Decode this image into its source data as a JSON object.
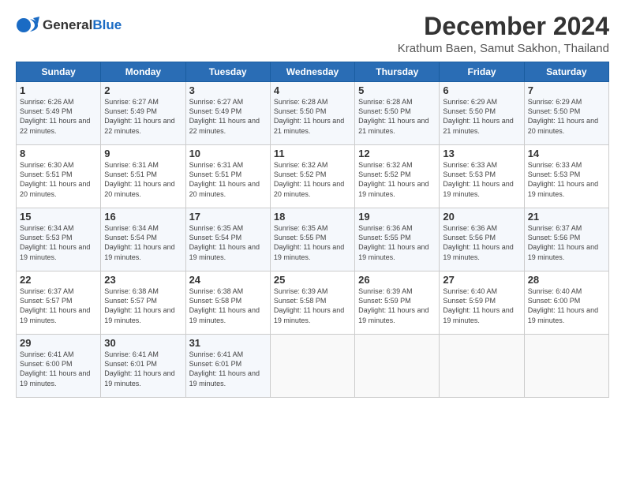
{
  "app": {
    "logo_general": "General",
    "logo_blue": "Blue"
  },
  "header": {
    "month": "December 2024",
    "location": "Krathum Baen, Samut Sakhon, Thailand"
  },
  "weekdays": [
    "Sunday",
    "Monday",
    "Tuesday",
    "Wednesday",
    "Thursday",
    "Friday",
    "Saturday"
  ],
  "weeks": [
    [
      {
        "day": "1",
        "sunrise": "Sunrise: 6:26 AM",
        "sunset": "Sunset: 5:49 PM",
        "daylight": "Daylight: 11 hours and 22 minutes."
      },
      {
        "day": "2",
        "sunrise": "Sunrise: 6:27 AM",
        "sunset": "Sunset: 5:49 PM",
        "daylight": "Daylight: 11 hours and 22 minutes."
      },
      {
        "day": "3",
        "sunrise": "Sunrise: 6:27 AM",
        "sunset": "Sunset: 5:49 PM",
        "daylight": "Daylight: 11 hours and 22 minutes."
      },
      {
        "day": "4",
        "sunrise": "Sunrise: 6:28 AM",
        "sunset": "Sunset: 5:50 PM",
        "daylight": "Daylight: 11 hours and 21 minutes."
      },
      {
        "day": "5",
        "sunrise": "Sunrise: 6:28 AM",
        "sunset": "Sunset: 5:50 PM",
        "daylight": "Daylight: 11 hours and 21 minutes."
      },
      {
        "day": "6",
        "sunrise": "Sunrise: 6:29 AM",
        "sunset": "Sunset: 5:50 PM",
        "daylight": "Daylight: 11 hours and 21 minutes."
      },
      {
        "day": "7",
        "sunrise": "Sunrise: 6:29 AM",
        "sunset": "Sunset: 5:50 PM",
        "daylight": "Daylight: 11 hours and 20 minutes."
      }
    ],
    [
      {
        "day": "8",
        "sunrise": "Sunrise: 6:30 AM",
        "sunset": "Sunset: 5:51 PM",
        "daylight": "Daylight: 11 hours and 20 minutes."
      },
      {
        "day": "9",
        "sunrise": "Sunrise: 6:31 AM",
        "sunset": "Sunset: 5:51 PM",
        "daylight": "Daylight: 11 hours and 20 minutes."
      },
      {
        "day": "10",
        "sunrise": "Sunrise: 6:31 AM",
        "sunset": "Sunset: 5:51 PM",
        "daylight": "Daylight: 11 hours and 20 minutes."
      },
      {
        "day": "11",
        "sunrise": "Sunrise: 6:32 AM",
        "sunset": "Sunset: 5:52 PM",
        "daylight": "Daylight: 11 hours and 20 minutes."
      },
      {
        "day": "12",
        "sunrise": "Sunrise: 6:32 AM",
        "sunset": "Sunset: 5:52 PM",
        "daylight": "Daylight: 11 hours and 19 minutes."
      },
      {
        "day": "13",
        "sunrise": "Sunrise: 6:33 AM",
        "sunset": "Sunset: 5:53 PM",
        "daylight": "Daylight: 11 hours and 19 minutes."
      },
      {
        "day": "14",
        "sunrise": "Sunrise: 6:33 AM",
        "sunset": "Sunset: 5:53 PM",
        "daylight": "Daylight: 11 hours and 19 minutes."
      }
    ],
    [
      {
        "day": "15",
        "sunrise": "Sunrise: 6:34 AM",
        "sunset": "Sunset: 5:53 PM",
        "daylight": "Daylight: 11 hours and 19 minutes."
      },
      {
        "day": "16",
        "sunrise": "Sunrise: 6:34 AM",
        "sunset": "Sunset: 5:54 PM",
        "daylight": "Daylight: 11 hours and 19 minutes."
      },
      {
        "day": "17",
        "sunrise": "Sunrise: 6:35 AM",
        "sunset": "Sunset: 5:54 PM",
        "daylight": "Daylight: 11 hours and 19 minutes."
      },
      {
        "day": "18",
        "sunrise": "Sunrise: 6:35 AM",
        "sunset": "Sunset: 5:55 PM",
        "daylight": "Daylight: 11 hours and 19 minutes."
      },
      {
        "day": "19",
        "sunrise": "Sunrise: 6:36 AM",
        "sunset": "Sunset: 5:55 PM",
        "daylight": "Daylight: 11 hours and 19 minutes."
      },
      {
        "day": "20",
        "sunrise": "Sunrise: 6:36 AM",
        "sunset": "Sunset: 5:56 PM",
        "daylight": "Daylight: 11 hours and 19 minutes."
      },
      {
        "day": "21",
        "sunrise": "Sunrise: 6:37 AM",
        "sunset": "Sunset: 5:56 PM",
        "daylight": "Daylight: 11 hours and 19 minutes."
      }
    ],
    [
      {
        "day": "22",
        "sunrise": "Sunrise: 6:37 AM",
        "sunset": "Sunset: 5:57 PM",
        "daylight": "Daylight: 11 hours and 19 minutes."
      },
      {
        "day": "23",
        "sunrise": "Sunrise: 6:38 AM",
        "sunset": "Sunset: 5:57 PM",
        "daylight": "Daylight: 11 hours and 19 minutes."
      },
      {
        "day": "24",
        "sunrise": "Sunrise: 6:38 AM",
        "sunset": "Sunset: 5:58 PM",
        "daylight": "Daylight: 11 hours and 19 minutes."
      },
      {
        "day": "25",
        "sunrise": "Sunrise: 6:39 AM",
        "sunset": "Sunset: 5:58 PM",
        "daylight": "Daylight: 11 hours and 19 minutes."
      },
      {
        "day": "26",
        "sunrise": "Sunrise: 6:39 AM",
        "sunset": "Sunset: 5:59 PM",
        "daylight": "Daylight: 11 hours and 19 minutes."
      },
      {
        "day": "27",
        "sunrise": "Sunrise: 6:40 AM",
        "sunset": "Sunset: 5:59 PM",
        "daylight": "Daylight: 11 hours and 19 minutes."
      },
      {
        "day": "28",
        "sunrise": "Sunrise: 6:40 AM",
        "sunset": "Sunset: 6:00 PM",
        "daylight": "Daylight: 11 hours and 19 minutes."
      }
    ],
    [
      {
        "day": "29",
        "sunrise": "Sunrise: 6:41 AM",
        "sunset": "Sunset: 6:00 PM",
        "daylight": "Daylight: 11 hours and 19 minutes."
      },
      {
        "day": "30",
        "sunrise": "Sunrise: 6:41 AM",
        "sunset": "Sunset: 6:01 PM",
        "daylight": "Daylight: 11 hours and 19 minutes."
      },
      {
        "day": "31",
        "sunrise": "Sunrise: 6:41 AM",
        "sunset": "Sunset: 6:01 PM",
        "daylight": "Daylight: 11 hours and 19 minutes."
      },
      null,
      null,
      null,
      null
    ]
  ]
}
